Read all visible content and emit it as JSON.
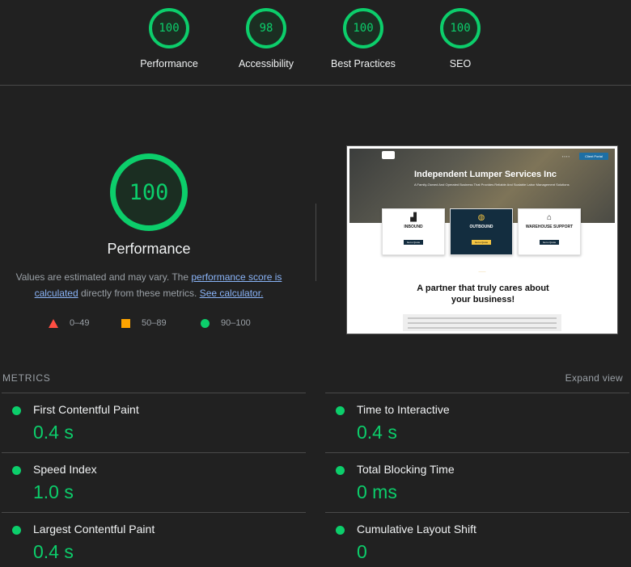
{
  "summary_gauges": [
    {
      "score": "100",
      "label": "Performance"
    },
    {
      "score": "98",
      "label": "Accessibility"
    },
    {
      "score": "100",
      "label": "Best Practices"
    },
    {
      "score": "100",
      "label": "SEO"
    }
  ],
  "performance": {
    "score": "100",
    "title": "Performance",
    "desc_prefix": "Values are estimated and may vary. The ",
    "score_link": "performance score is calculated",
    "desc_middle": " directly from these metrics. ",
    "calc_link": "See calculator."
  },
  "legend": [
    {
      "shape": "triangle",
      "range": "0–49",
      "color": "#ff4e42"
    },
    {
      "shape": "square",
      "range": "50–89",
      "color": "#ffa400"
    },
    {
      "shape": "circle",
      "range": "90–100",
      "color": "#0cce6b"
    }
  ],
  "thumbnail": {
    "headline": "Independent Lumper Services Inc",
    "subheadline": "A Family-Owned And Operated Business That Provides Reliable And Scalable Labor Management Solutions",
    "client_portal": "Client Portal",
    "cards": [
      {
        "title": "INBOUND",
        "button": "Get a Quote"
      },
      {
        "title": "OUTBOUND",
        "button": "Get a Quote"
      },
      {
        "title": "WAREHOUSE SUPPORT",
        "button": "Get a Quote"
      }
    ],
    "partner_heading": "A partner that truly cares about your business!"
  },
  "metrics": {
    "section_label": "METRICS",
    "expand_label": "Expand view",
    "items": [
      {
        "name": "First Contentful Paint",
        "value": "0.4 s"
      },
      {
        "name": "Time to Interactive",
        "value": "0.4 s"
      },
      {
        "name": "Speed Index",
        "value": "1.0 s"
      },
      {
        "name": "Total Blocking Time",
        "value": "0 ms"
      },
      {
        "name": "Largest Contentful Paint",
        "value": "0.4 s"
      },
      {
        "name": "Cumulative Layout Shift",
        "value": "0"
      }
    ]
  },
  "colors": {
    "pass": "#0cce6b",
    "average": "#ffa400",
    "fail": "#ff4e42",
    "link": "#8ab4f8",
    "background": "#212121"
  }
}
